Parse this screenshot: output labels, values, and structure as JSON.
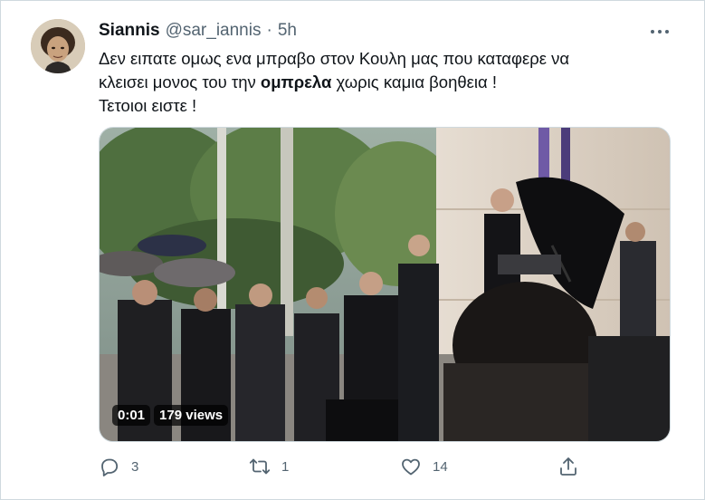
{
  "user": {
    "name": "Siannis",
    "handle": "@sar_iannis",
    "separator": "·",
    "time": "5h"
  },
  "tweet": {
    "line1": "Δεν ειπατε ομως ενα μπραβο στον Κουλη μας που καταφερε να",
    "line2_before": "κλεισει μονος του την ",
    "line2_bold": "ομπρελα",
    "line2_after": " χωρις καμια βοηθεια !",
    "line3": "Τετοιοι ειστε !"
  },
  "video": {
    "duration": "0:01",
    "views": "179 views"
  },
  "actions": {
    "replies": "3",
    "retweets": "1",
    "likes": "14"
  },
  "colors": {
    "text": "#0f1419",
    "secondary": "#536471",
    "border": "#cfd9de"
  },
  "icons": [
    "more-icon",
    "reply-icon",
    "retweet-icon",
    "like-icon",
    "share-icon"
  ]
}
